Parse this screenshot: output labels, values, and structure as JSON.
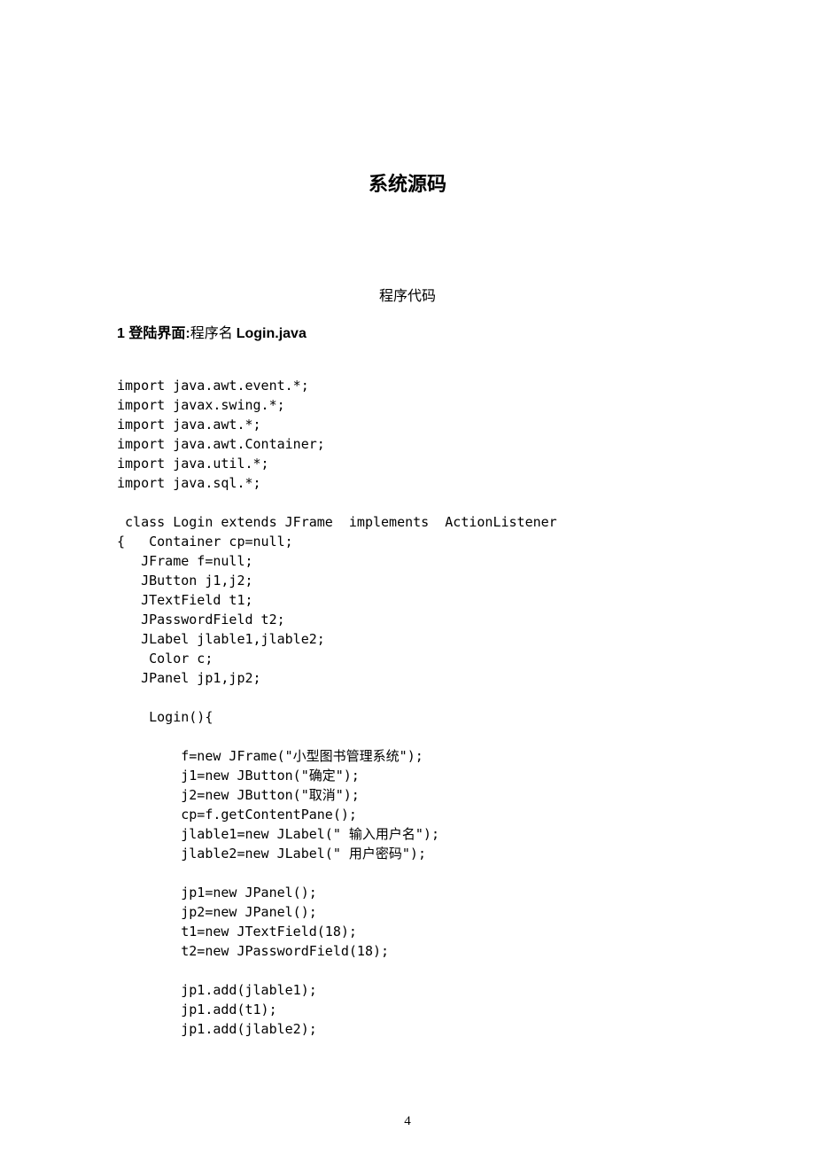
{
  "title": "系统源码",
  "subtitle": "程序代码",
  "section": {
    "number": "1",
    "label_bold": "登陆界面:",
    "label_normal": "程序名",
    "filename": "Login.java"
  },
  "code": "import java.awt.event.*;\nimport javax.swing.*;\nimport java.awt.*;\nimport java.awt.Container;\nimport java.util.*;\nimport java.sql.*;\n\n class Login extends JFrame  implements  ActionListener\n{   Container cp=null;\n   JFrame f=null;\n   JButton j1,j2;\n   JTextField t1;\n   JPasswordField t2;\n   JLabel jlable1,jlable2;\n    Color c;\n   JPanel jp1,jp2;\n\n    Login(){\n\n        f=new JFrame(\"小型图书管理系统\");\n        j1=new JButton(\"确定\");\n        j2=new JButton(\"取消\");\n        cp=f.getContentPane();\n        jlable1=new JLabel(\" 输入用户名\");\n        jlable2=new JLabel(\" 用户密码\");\n\n        jp1=new JPanel();\n        jp2=new JPanel();\n        t1=new JTextField(18);\n        t2=new JPasswordField(18);\n\n        jp1.add(jlable1);\n        jp1.add(t1);\n        jp1.add(jlable2);",
  "page_number": "4"
}
